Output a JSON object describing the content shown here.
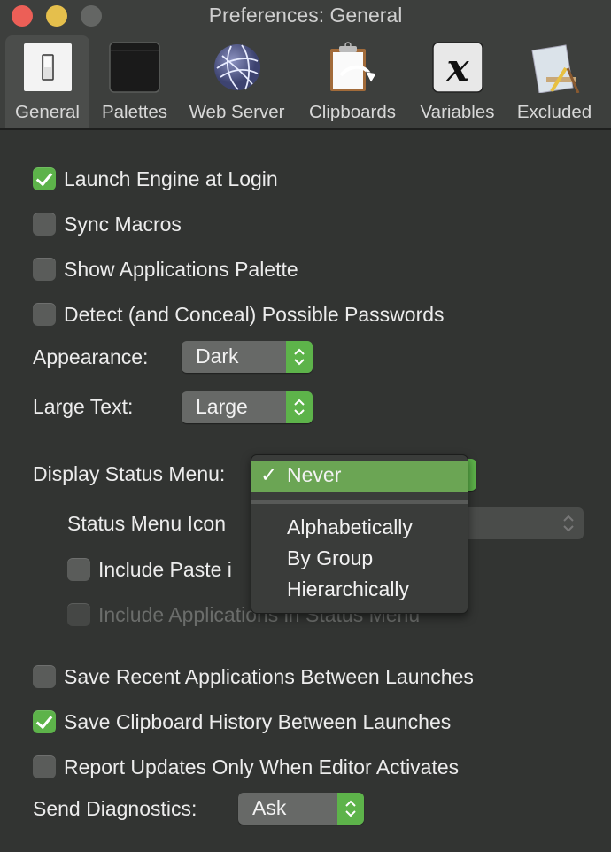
{
  "window": {
    "title": "Preferences: General"
  },
  "toolbar": {
    "tabs": [
      {
        "label": "General",
        "icon": "switch-icon",
        "active": true
      },
      {
        "label": "Palettes",
        "icon": "palette-window-icon",
        "active": false
      },
      {
        "label": "Web Server",
        "icon": "globe-icon",
        "active": false
      },
      {
        "label": "Clipboards",
        "icon": "clipboard-icon",
        "active": false
      },
      {
        "label": "Variables",
        "icon": "variable-x-icon",
        "active": false
      },
      {
        "label": "Excluded",
        "icon": "app-excluded-icon",
        "active": false
      }
    ]
  },
  "settings": {
    "launch_engine": {
      "label": "Launch Engine at Login",
      "checked": true
    },
    "sync_macros": {
      "label": "Sync Macros",
      "checked": false
    },
    "show_apps_palette": {
      "label": "Show Applications Palette",
      "checked": false
    },
    "detect_passwords": {
      "label": "Detect (and Conceal) Possible Passwords",
      "checked": false
    },
    "appearance": {
      "label": "Appearance:",
      "value": "Dark"
    },
    "large_text": {
      "label": "Large Text:",
      "value": "Large"
    },
    "display_status_menu": {
      "label": "Display Status Menu:",
      "value": "Never"
    },
    "status_menu_icon": {
      "label": "Status Menu Icon"
    },
    "include_paste": {
      "label": "Include Paste i",
      "checked": false
    },
    "include_apps": {
      "label": "Include Applications in Status Menu",
      "checked": false,
      "disabled": true
    },
    "save_recent_apps": {
      "label": "Save Recent Applications Between Launches",
      "checked": false
    },
    "save_clipboard": {
      "label": "Save Clipboard History Between Launches",
      "checked": true
    },
    "report_updates": {
      "label": "Report Updates Only When Editor Activates",
      "checked": false
    },
    "send_diagnostics": {
      "label": "Send Diagnostics:",
      "value": "Ask"
    }
  },
  "dropdown_menu": {
    "selected": "Never",
    "check": "✓",
    "items": [
      "Alphabetically",
      "By Group",
      "Hierarchically"
    ]
  },
  "colors": {
    "accent": "#5db34a",
    "menu_highlight": "#6ba554",
    "background": "#323432"
  }
}
